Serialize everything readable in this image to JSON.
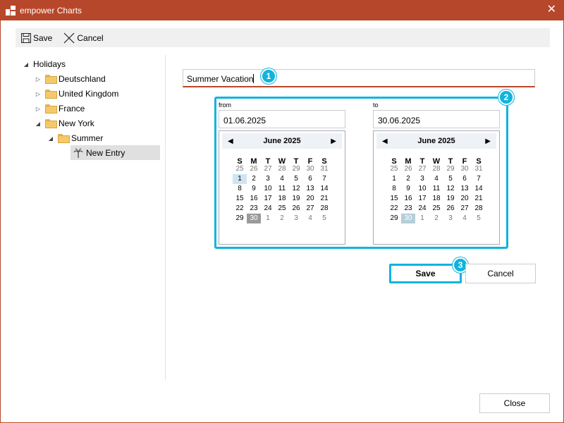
{
  "window": {
    "title": "empower Charts",
    "close_glyph": "✕"
  },
  "toolbar": {
    "save_label": "Save",
    "cancel_label": "Cancel"
  },
  "tree": {
    "root": "Holidays",
    "items": [
      "Deutschland",
      "United Kingdom",
      "France",
      "New York"
    ],
    "child": "Summer",
    "leaf": "New Entry"
  },
  "name_field": {
    "value": "Summer Vacation"
  },
  "callouts": [
    "1",
    "2",
    "3"
  ],
  "from": {
    "label": "from",
    "value": "01.06.2025",
    "month": "June 2025",
    "days": [
      "S",
      "M",
      "T",
      "W",
      "T",
      "F",
      "S"
    ],
    "weeks": [
      [
        "25",
        "26",
        "27",
        "28",
        "29",
        "30",
        "31"
      ],
      [
        "1",
        "2",
        "3",
        "4",
        "5",
        "6",
        "7"
      ],
      [
        "8",
        "9",
        "10",
        "11",
        "12",
        "13",
        "14"
      ],
      [
        "15",
        "16",
        "17",
        "18",
        "19",
        "20",
        "21"
      ],
      [
        "22",
        "23",
        "24",
        "25",
        "26",
        "27",
        "28"
      ],
      [
        "29",
        "30",
        "1",
        "2",
        "3",
        "4",
        "5"
      ]
    ]
  },
  "to": {
    "label": "to",
    "value": "30.06.2025",
    "month": "June 2025",
    "days": [
      "S",
      "M",
      "T",
      "W",
      "T",
      "F",
      "S"
    ],
    "weeks": [
      [
        "25",
        "26",
        "27",
        "28",
        "29",
        "30",
        "31"
      ],
      [
        "1",
        "2",
        "3",
        "4",
        "5",
        "6",
        "7"
      ],
      [
        "8",
        "9",
        "10",
        "11",
        "12",
        "13",
        "14"
      ],
      [
        "15",
        "16",
        "17",
        "18",
        "19",
        "20",
        "21"
      ],
      [
        "22",
        "23",
        "24",
        "25",
        "26",
        "27",
        "28"
      ],
      [
        "29",
        "30",
        "1",
        "2",
        "3",
        "4",
        "5"
      ]
    ]
  },
  "buttons": {
    "save": "Save",
    "cancel": "Cancel",
    "close": "Close"
  },
  "colors": {
    "titlebar": "#b7472a",
    "highlight": "#10b4dc"
  }
}
